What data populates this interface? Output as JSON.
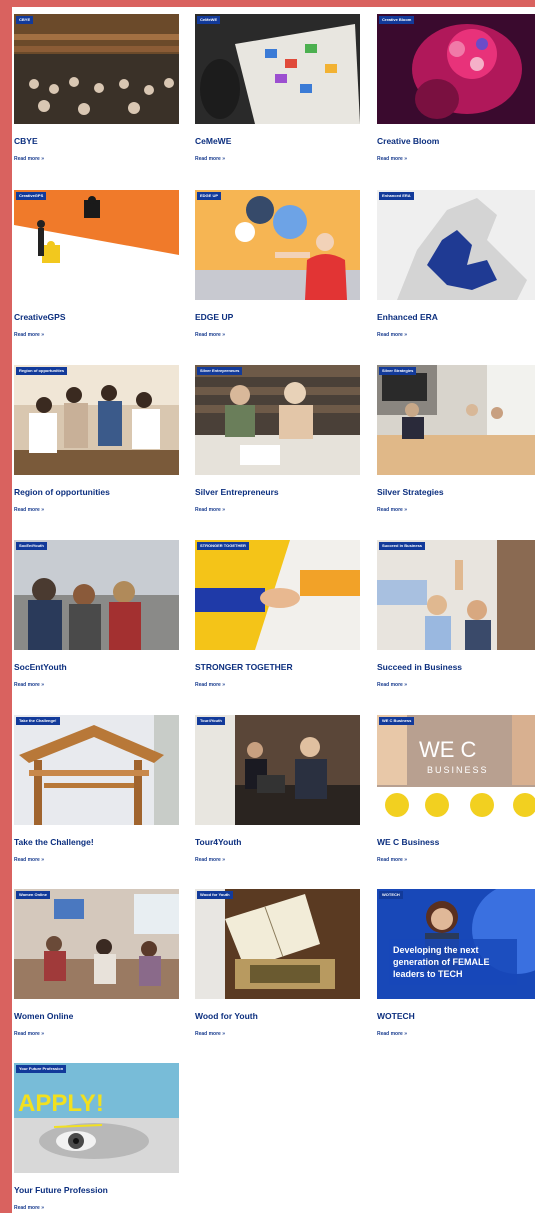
{
  "readmore_label": "Read more »",
  "cards": [
    {
      "tag": "CBYE",
      "title": "CBYE"
    },
    {
      "tag": "CeMeWE",
      "title": "CeMeWE"
    },
    {
      "tag": "Creative Bloom",
      "title": "Creative Bloom"
    },
    {
      "tag": "CreativeGPS",
      "title": "CreativeGPS"
    },
    {
      "tag": "EDGE UP",
      "title": "EDGE UP"
    },
    {
      "tag": "Enhanced ERA",
      "title": "Enhanced ERA"
    },
    {
      "tag": "Region of opportunities",
      "title": "Region of opportunities"
    },
    {
      "tag": "Silver Entrepreneurs",
      "title": "Silver Entrepreneurs"
    },
    {
      "tag": "Silver Strategies",
      "title": "Silver Strategies"
    },
    {
      "tag": "SocEntYouth",
      "title": "SocEntYouth"
    },
    {
      "tag": "STRONGER TOGETHER",
      "title": "STRONGER TOGETHER"
    },
    {
      "tag": "Succeed in Business",
      "title": "Succeed in Business"
    },
    {
      "tag": "Take the Challenge!",
      "title": "Take the Challenge!"
    },
    {
      "tag": "Tour4Youth",
      "title": "Tour4Youth"
    },
    {
      "tag": "WE C Business",
      "title": "WE C Business"
    },
    {
      "tag": "Women Online",
      "title": "Women Online"
    },
    {
      "tag": "Wood for Youth",
      "title": "Wood for Youth"
    },
    {
      "tag": "WOTECH",
      "title": "WOTECH"
    },
    {
      "tag": "Your Future Profession",
      "title": "Your Future Profession"
    }
  ],
  "image_text": {
    "wec_logo": "WE C",
    "wec_sub": "BUSINESS",
    "wotech_line1": "Developing the next",
    "wotech_line2": "generation of FEMALE",
    "wotech_line3": "leaders to TECH",
    "apply": "APPLY!"
  },
  "colors": {
    "accent_blue": "#123a9a",
    "title_blue": "#0c2f7f",
    "frame_red": "#d9625f"
  }
}
